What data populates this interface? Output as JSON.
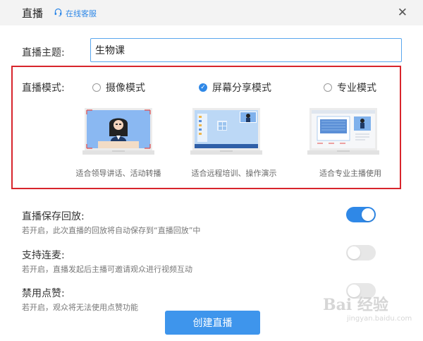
{
  "dialog": {
    "title": "直播",
    "customer_service": "在线客服",
    "close_icon": "close-icon"
  },
  "topic": {
    "label": "直播主题:",
    "value": "生物课"
  },
  "mode": {
    "label": "直播模式:",
    "selected": "屏幕分享模式",
    "options": [
      {
        "label": "摄像模式",
        "checked": false,
        "caption": "适合领导讲话、活动转播",
        "thumbnail": "camera-mode-illustration"
      },
      {
        "label": "屏幕分享模式",
        "checked": true,
        "caption": "适合远程培训、操作演示",
        "thumbnail": "screen-share-mode-illustration"
      },
      {
        "label": "专业模式",
        "checked": false,
        "caption": "适合专业主播使用",
        "thumbnail": "professional-mode-illustration"
      }
    ]
  },
  "settings": [
    {
      "title": "直播保存回放:",
      "desc": "若开启，此次直播的回放将自动保存到“直播回放”中",
      "enabled": true
    },
    {
      "title": "支持连麦:",
      "desc": "若开启，直播发起后主播可邀请观众进行视频互动",
      "enabled": false
    },
    {
      "title": "禁用点赞:",
      "desc": "若开启，观众将无法使用点赞功能",
      "enabled": false
    }
  ],
  "create_button": "创建直播",
  "watermark": {
    "main": "Bai 经验",
    "sub": "jingyan.baidu.com"
  },
  "colors": {
    "accent": "#2f88e7",
    "highlight_border": "#d8252c"
  }
}
